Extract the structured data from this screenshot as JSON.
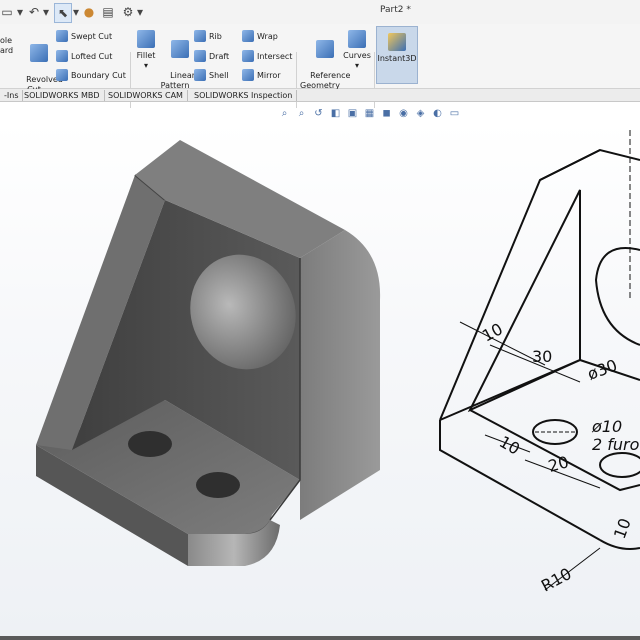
{
  "window": {
    "title": "Part2 *"
  },
  "ribbon": {
    "revolved_label": "ole\nard",
    "revolved_cut_label": "Revolved\nCut",
    "swept_cut_label": "Swept Cut",
    "lofted_cut_label": "Lofted Cut",
    "boundary_cut_label": "Boundary Cut",
    "fillet_label": "Fillet",
    "linear_pattern_label": "Linear\nPattern",
    "rib_label": "Rib",
    "draft_label": "Draft",
    "shell_label": "Shell",
    "wrap_label": "Wrap",
    "intersect_label": "Intersect",
    "mirror_label": "Mirror",
    "reference_geometry_label": "Reference\nGeometry",
    "curves_label": "Curves",
    "instant3d_label": "Instant3D"
  },
  "tabs": [
    {
      "label": "-Ins"
    },
    {
      "label": "SOLIDWORKS MBD"
    },
    {
      "label": "SOLIDWORKS CAM"
    },
    {
      "label": "SOLIDWORKS Inspection"
    }
  ],
  "drawing": {
    "dim_10_top": "10",
    "dim_30": "30",
    "dim_dia30": "ø30",
    "dim_dia10": "ø10",
    "dim_2_furo": "2 furo",
    "dim_10_base": "10",
    "dim_20": "20",
    "dim_10_right": "10",
    "dim_r10": "R10"
  },
  "colors": {
    "model_dark": "#4e4e4e",
    "model_mid": "#7a7a7a",
    "model_light": "#a9a9a9",
    "accent": "#3b6fb5"
  }
}
